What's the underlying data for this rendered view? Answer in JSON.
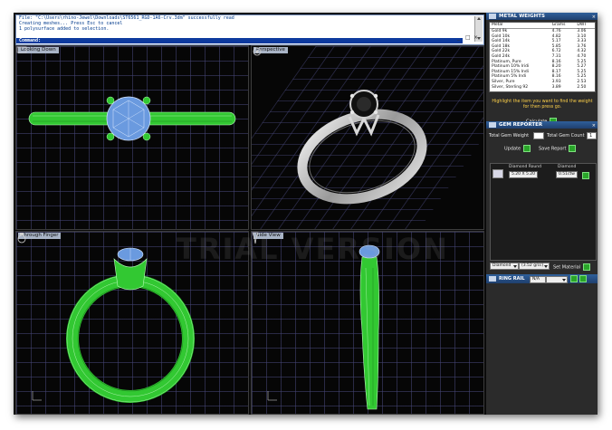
{
  "command": {
    "lines": [
      "File: \"C:\\Users\\rhino-Jewel\\Downloads\\ST6561_RGD-1A6-Crv.3dm\" successfully read",
      "Creating meshes... Press Esc to cancel",
      "1 polysurface added to selection."
    ],
    "prompt": "Command:"
  },
  "viewports": {
    "top_left": "Looking Down",
    "top_right": "Perspective",
    "bottom_left": "Through Finger",
    "bottom_right": "Side View"
  },
  "metal_weights": {
    "title": "METAL WEIGHTS",
    "columns": [
      "Metal",
      "Grams",
      "DWT"
    ],
    "rows": [
      [
        "Gold 9k",
        "4.76",
        "3.06"
      ],
      [
        "Gold 10k",
        "4.82",
        "3.10"
      ],
      [
        "Gold 14k",
        "5.17",
        "3.33"
      ],
      [
        "Gold 18k",
        "5.85",
        "3.76"
      ],
      [
        "Gold 22k",
        "6.72",
        "4.32"
      ],
      [
        "Gold 24k",
        "7.31",
        "4.70"
      ],
      [
        "Platinum, Pure",
        "8.16",
        "5.25"
      ],
      [
        "Platinum 10% Iridi",
        "8.20",
        "5.27"
      ],
      [
        "Platinum 15% Indi",
        "8.17",
        "5.25"
      ],
      [
        "Platinum 5% Indi",
        "8.16",
        "5.25"
      ],
      [
        "Silver, Pure",
        "3.93",
        "2.53"
      ],
      [
        "Silver, Sterling 92",
        "3.89",
        "2.50"
      ]
    ],
    "highlight_text": "Highlight the item you want to find the weight for then press go.",
    "calculate_label": "Calculate"
  },
  "gem_reporter": {
    "title": "GEM REPORTER",
    "total_weight_label": "Total Gem Weight",
    "total_weight_value": "",
    "total_count_label": "Total Gem Count",
    "total_count_value": "1",
    "update_label": "Update",
    "save_report_label": "Save Report",
    "col_shape": "Diamond Round",
    "col_type": "Diamond",
    "gem_size": "5.20 X 5.20",
    "gem_weight": "0.51ctw",
    "material_select": "Diamond",
    "material_value": "(3.52 g/cc)",
    "set_material_label": "Set Material"
  },
  "ring_rail": {
    "title": "RING RAIL",
    "size_value": "N/A"
  },
  "watermark": "TRIAL VERSION",
  "colors": {
    "ring_green": "#32c832",
    "gem_blue": "#6a9adf",
    "panel_bg": "#2b2b2b",
    "header_blue": "#2f5f9a"
  }
}
